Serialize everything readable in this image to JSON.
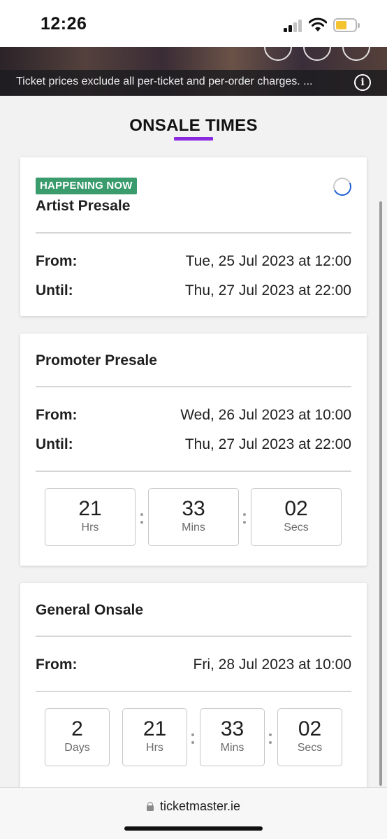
{
  "status_bar": {
    "time": "12:26",
    "battery_color": "#f4c430"
  },
  "notice": {
    "text": "Ticket prices exclude all per-ticket and per-order charges. ...",
    "icon": "info-icon"
  },
  "section": {
    "title": "ONSALE TIMES",
    "accent_color": "#8a2be2"
  },
  "cards": [
    {
      "badge": "HAPPENING NOW",
      "badge_color": "#3a9b6d",
      "title": "Artist Presale",
      "from_label": "From:",
      "from_value": "Tue, 25 Jul 2023 at 12:00",
      "until_label": "Until:",
      "until_value": "Thu, 27 Jul 2023 at 22:00"
    },
    {
      "title": "Promoter Presale",
      "from_label": "From:",
      "from_value": "Wed, 26 Jul 2023 at 10:00",
      "until_label": "Until:",
      "until_value": "Thu, 27 Jul 2023 at 22:00",
      "countdown": [
        {
          "value": "21",
          "unit": "Hrs"
        },
        {
          "value": "33",
          "unit": "Mins"
        },
        {
          "value": "02",
          "unit": "Secs"
        }
      ]
    },
    {
      "title": "General Onsale",
      "from_label": "From:",
      "from_value": "Fri, 28 Jul 2023 at 10:00",
      "countdown": [
        {
          "value": "2",
          "unit": "Days"
        },
        {
          "value": "21",
          "unit": "Hrs"
        },
        {
          "value": "33",
          "unit": "Mins"
        },
        {
          "value": "02",
          "unit": "Secs"
        }
      ]
    }
  ],
  "url_bar": {
    "domain": "ticketmaster.ie"
  }
}
